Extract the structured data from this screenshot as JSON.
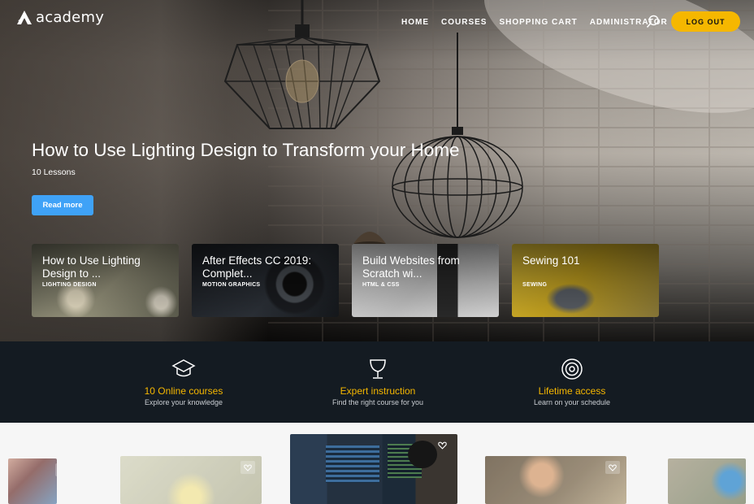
{
  "brand": {
    "name": "academy"
  },
  "nav": {
    "links": [
      "HOME",
      "COURSES",
      "SHOPPING CART",
      "ADMINISTRATOR"
    ],
    "logout_label": "LOG OUT",
    "search_icon": "search-icon"
  },
  "hero": {
    "title": "How to Use Lighting Design to Transform your Home",
    "lessons": "10 Lessons",
    "cta_label": "Read more"
  },
  "featured_courses": [
    {
      "title": "How to Use Lighting Design to ...",
      "category": "LIGHTING DESIGN"
    },
    {
      "title": "After Effects CC 2019: Complet...",
      "category": "MOTION GRAPHICS"
    },
    {
      "title": "Build Websites from Scratch wi...",
      "category": "HTML & CSS"
    },
    {
      "title": "Sewing 101",
      "category": "SEWING"
    }
  ],
  "features": [
    {
      "icon": "graduation-cap-icon",
      "title": "10 Online courses",
      "subtitle": "Explore your knowledge"
    },
    {
      "icon": "trophy-icon",
      "title": "Expert instruction",
      "subtitle": "Find the right course for you"
    },
    {
      "icon": "target-icon",
      "title": "Lifetime access",
      "subtitle": "Learn on your schedule"
    }
  ],
  "colors": {
    "accent": "#f5b700",
    "button_blue": "#3fa2f7",
    "feature_bar": "#141b22"
  }
}
